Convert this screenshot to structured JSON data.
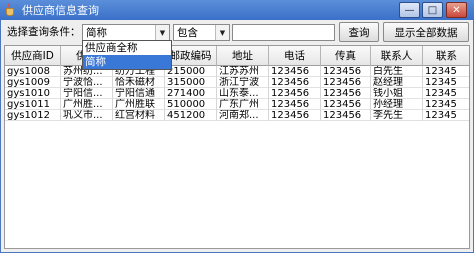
{
  "window": {
    "title": "供应商信息查询",
    "minimize_glyph": "—",
    "maximize_glyph": "□",
    "close_glyph": "✕"
  },
  "toolbar": {
    "label": "选择查询条件：",
    "field_combo_value": "简称",
    "operator_combo_value": "包含",
    "search_value": "",
    "search_button": "查询",
    "show_all_button": "显示全部数据",
    "arrow_glyph": "▼"
  },
  "dropdown": {
    "options": [
      "供应商全称",
      "简称"
    ],
    "selected_index": 1
  },
  "table": {
    "columns": [
      "供应商ID",
      "供应",
      "",
      "邮政编码",
      "地址",
      "电话",
      "传真",
      "联系人",
      "联系"
    ],
    "rows": [
      [
        "gys1008",
        "苏州纺...",
        "纺万工程",
        "215000",
        "江苏苏州",
        "123456",
        "123456",
        "白先生",
        "12345"
      ],
      [
        "gys1009",
        "宁波恰...",
        "恰禾磁材",
        "315000",
        "浙江宁波",
        "123456",
        "123456",
        "赵经理",
        "12345"
      ],
      [
        "gys1010",
        "宁阳信...",
        "宁阳信通",
        "271400",
        "山东泰...",
        "123456",
        "123456",
        "钱小姐",
        "12345"
      ],
      [
        "gys1011",
        "广州胜...",
        "广州胜联",
        "510000",
        "广东广州",
        "123456",
        "123456",
        "孙经理",
        "12345"
      ],
      [
        "gys1012",
        "巩义市...",
        "红宫材料",
        "451200",
        "河南郑...",
        "123456",
        "123456",
        "李先生",
        "12345"
      ]
    ]
  }
}
